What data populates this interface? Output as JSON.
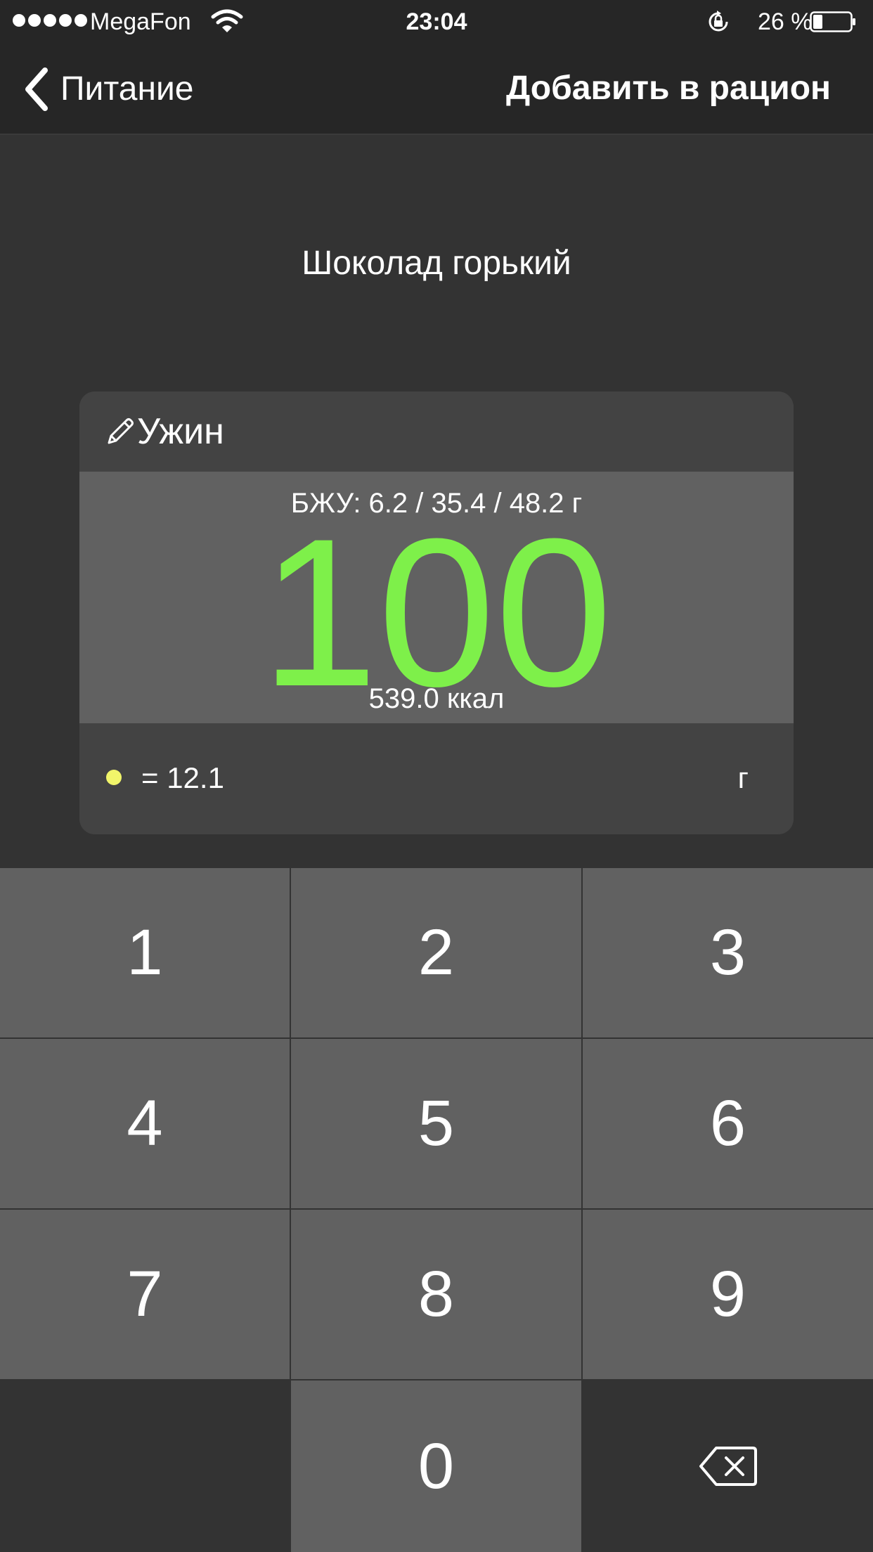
{
  "status_bar": {
    "carrier": "MegaFon",
    "time": "23:04",
    "battery_percent": "26 %",
    "battery_level": 0.26,
    "icons": [
      "signal-dots-icon",
      "wifi-icon",
      "rotation-lock-icon",
      "battery-icon"
    ]
  },
  "nav": {
    "back_label": "Питание",
    "action_label": "Добавить в рацион"
  },
  "product": {
    "name": "Шоколад горький"
  },
  "card": {
    "meal": "Ужин",
    "macros": "БЖУ: 6.2 / 35.4 / 48.2 г",
    "amount": "100",
    "kcal": "539.0 ккал",
    "equivalent": "= 12.1",
    "unit": "г"
  },
  "colors": {
    "amount": "#7ef04a",
    "indicator_dot": "#f1f56a",
    "background": "#333333",
    "key": "#616161"
  },
  "keypad": {
    "keys": [
      "1",
      "2",
      "3",
      "4",
      "5",
      "6",
      "7",
      "8",
      "9",
      "0"
    ],
    "delete_icon": "backspace-icon"
  }
}
